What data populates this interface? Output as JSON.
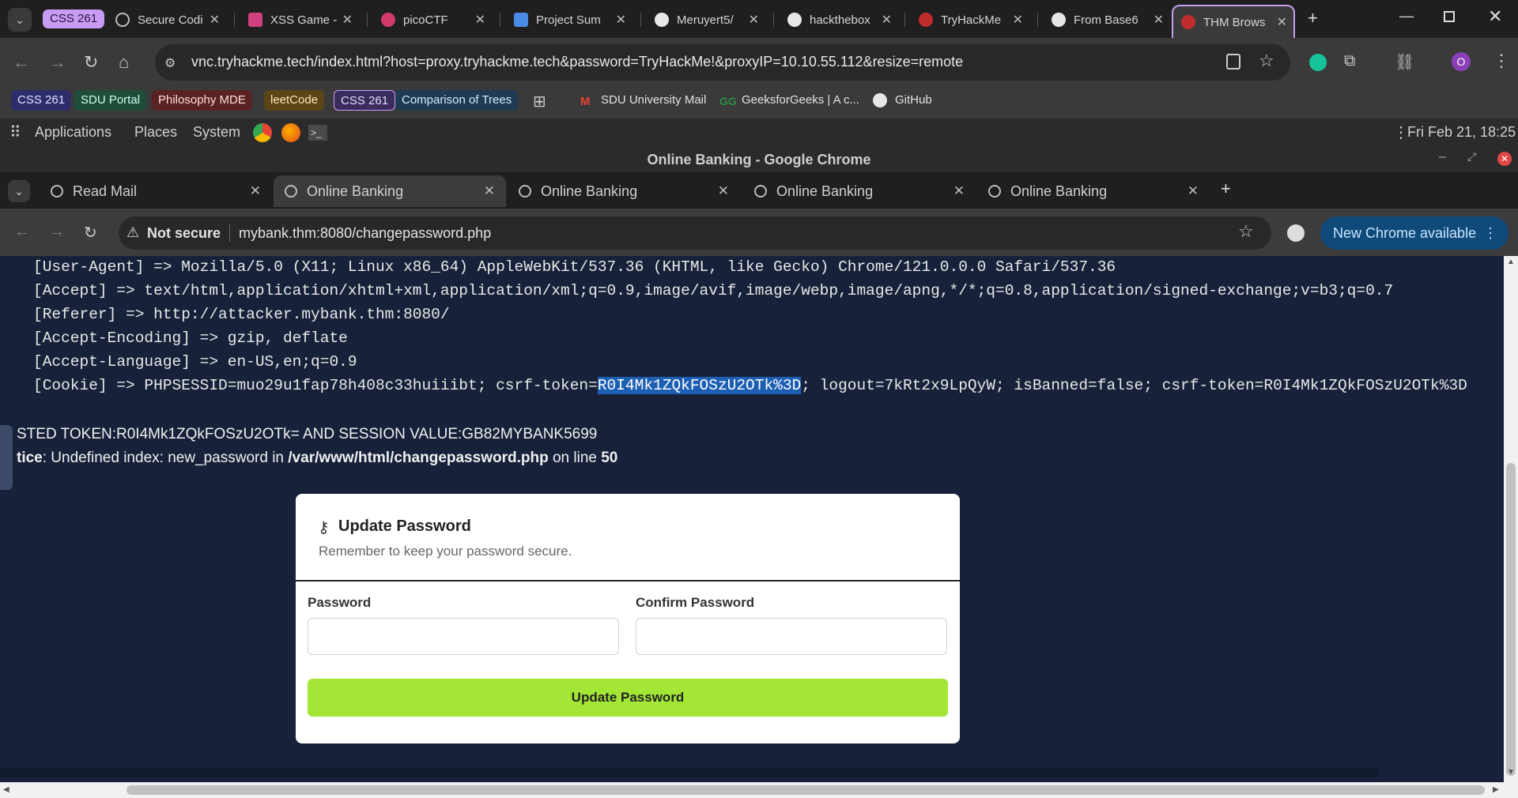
{
  "outer_tabs": [
    {
      "label": "Secure Codi"
    },
    {
      "label": "XSS Game -"
    },
    {
      "label": "picoCTF"
    },
    {
      "label": "Project Sum"
    },
    {
      "label": "Meruyert5/"
    },
    {
      "label": "hackthebox"
    },
    {
      "label": "TryHackMe"
    },
    {
      "label": "From Base6"
    },
    {
      "label": "THM Brows"
    }
  ],
  "outer_group": "CSS 261",
  "outer_url": "vnc.tryhackme.tech/index.html?host=proxy.tryhackme.tech&password=TryHackMe!&proxyIP=10.10.55.112&resize=remote",
  "profile_initial": "O",
  "bookmarks": [
    {
      "label": "CSS 261",
      "color": "#2d2d6b",
      "fg": "#e0e0ff"
    },
    {
      "label": "SDU Portal",
      "color": "#1f4d3a",
      "fg": "#cfe"
    },
    {
      "label": "Philosophy MDE",
      "color": "#5a2323",
      "fg": "#fdd"
    },
    {
      "label": "leetCode",
      "color": "#5a4418",
      "fg": "#ffe9b8"
    },
    {
      "label": "CSS 261",
      "color": "#3a2d5e",
      "fg": "#e6d9ff"
    },
    {
      "label": "Comparison of Trees",
      "color": "#1f3a52",
      "fg": "#d4ecff"
    },
    {
      "label": "SDU University Mail",
      "color": "transparent",
      "fg": "#e3e3e3"
    },
    {
      "label": "GeeksforGeeks | A c...",
      "color": "transparent",
      "fg": "#e3e3e3"
    },
    {
      "label": "GitHub",
      "color": "transparent",
      "fg": "#e3e3e3"
    }
  ],
  "gnome": {
    "applications": "Applications",
    "places": "Places",
    "system": "System",
    "clock": "Fri Feb 21, 18:25"
  },
  "inner_window_title": "Online Banking - Google Chrome",
  "inner_tabs": [
    {
      "label": "Read Mail"
    },
    {
      "label": "Online Banking"
    },
    {
      "label": "Online Banking"
    },
    {
      "label": "Online Banking"
    },
    {
      "label": "Online Banking"
    }
  ],
  "inner_security": "Not secure",
  "inner_url": "mybank.thm:8080/changepassword.php",
  "new_chrome": "New Chrome available",
  "headers": [
    "[User-Agent] => Mozilla/5.0 (X11; Linux x86_64) AppleWebKit/537.36 (KHTML, like Gecko) Chrome/121.0.0.0 Safari/537.36",
    "[Accept] => text/html,application/xhtml+xml,application/xml;q=0.9,image/avif,image/webp,image/apng,*/*;q=0.8,application/signed-exchange;v=b3;q=0.7",
    "[Referer] => http://attacker.mybank.thm:8080/",
    "[Accept-Encoding] => gzip, deflate",
    "[Accept-Language] => en-US,en;q=0.9"
  ],
  "cookie": {
    "prefix": "[Cookie] => PHPSESSID=muo29u1fap78h408c33huiiibt; csrf-token=",
    "highlighted": "R0I4Mk1ZQkFOSzU2OTk%3D",
    "suffix": "; logout=7kRt2x9LpQyW; isBanned=false; csrf-token=R0I4Mk1ZQkFOSzU2OTk%3D"
  },
  "posted_line": "STED TOKEN:R0I4Mk1ZQkFOSzU2OTk= AND SESSION VALUE:GB82MYBANK5699",
  "notice": {
    "prefix": "tice",
    "message": ": Undefined index: new_password in ",
    "path": "/var/www/html/changepassword.php",
    "on_line": " on line ",
    "line": "50"
  },
  "form": {
    "title": "Update Password",
    "subtitle": "Remember to keep your password secure.",
    "password_label": "Password",
    "confirm_label": "Confirm Password",
    "password_value": "",
    "confirm_value": "",
    "submit_label": "Update Password",
    "accent_color": "#a3e635"
  }
}
